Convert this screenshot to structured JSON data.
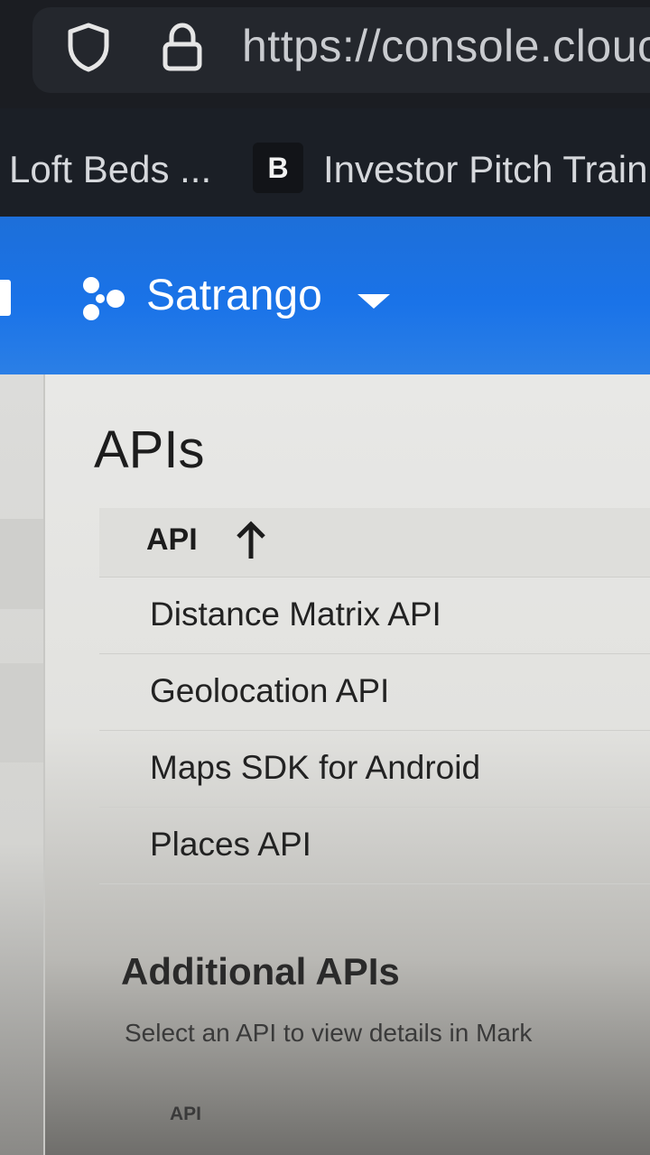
{
  "browser": {
    "url": "https://console.clouc",
    "bookmarks": [
      {
        "label": "Loft Beds ..."
      },
      {
        "badge": "B",
        "label": "Investor Pitch Traini"
      }
    ]
  },
  "header": {
    "project_name": "Satrango",
    "icons": {
      "project": "project-nodes-icon",
      "dropdown": "caret-down-icon"
    }
  },
  "main": {
    "title": "APIs",
    "table": {
      "column": "API",
      "sort": "ascending",
      "rows": [
        {
          "name": "Distance Matrix API"
        },
        {
          "name": "Geolocation API"
        },
        {
          "name": "Maps SDK for Android"
        },
        {
          "name": "Places API"
        }
      ]
    },
    "additional": {
      "title": "Additional APIs",
      "subtitle": "Select an API to view details in Mark",
      "column": "API"
    }
  },
  "colors": {
    "header_blue": "#1a73e8",
    "content_bg": "#e8e8e6"
  }
}
